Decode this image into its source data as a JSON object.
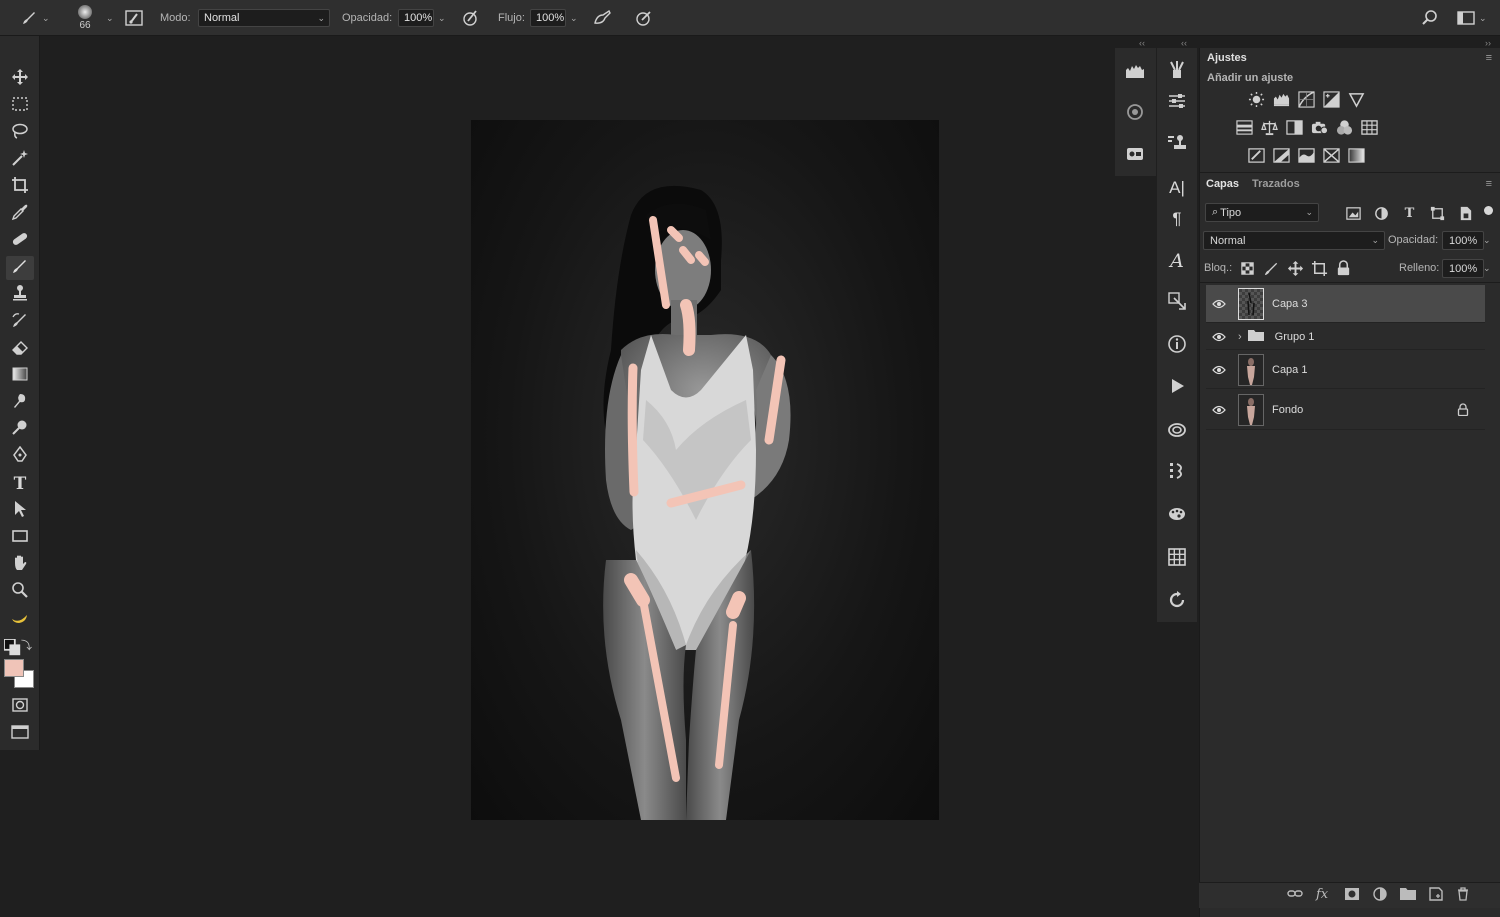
{
  "options_bar": {
    "brush_size": "66",
    "mode_label": "Modo:",
    "mode_value": "Normal",
    "opacity_label": "Opacidad:",
    "opacity_value": "100%",
    "flow_label": "Flujo:",
    "flow_value": "100%"
  },
  "colors": {
    "foreground": "#f0c4b8",
    "background": "#ffffff",
    "paint": "#f3c4b6",
    "selected_layer": "#4a4a4a"
  },
  "adjustments": {
    "title": "Ajustes",
    "subtitle": "Añadir un ajuste",
    "rows": [
      [
        "brightness-icon",
        "levels-icon",
        "curves-icon",
        "exposure-icon",
        "vibrance-icon"
      ],
      [
        "hue-saturation-icon",
        "color-balance-icon",
        "black-white-icon",
        "photo-filter-icon",
        "channel-mixer-icon",
        "color-lookup-icon"
      ],
      [
        "invert-icon",
        "posterize-icon",
        "threshold-icon",
        "selective-color-icon",
        "gradient-map-icon"
      ]
    ]
  },
  "layers_panel": {
    "tabs": [
      "Capas",
      "Trazados"
    ],
    "filter_value": "Tipo",
    "blend_mode": "Normal",
    "opacity_label": "Opacidad:",
    "opacity_value": "100%",
    "lock_label": "Bloq.:",
    "fill_label": "Relleno:",
    "fill_value": "100%",
    "layers": [
      {
        "name": "Capa 3",
        "type": "layer",
        "selected": true
      },
      {
        "name": "Grupo 1",
        "type": "group",
        "selected": false
      },
      {
        "name": "Capa 1",
        "type": "layer",
        "selected": false
      },
      {
        "name": "Fondo",
        "type": "background",
        "selected": false,
        "locked": true
      }
    ]
  }
}
